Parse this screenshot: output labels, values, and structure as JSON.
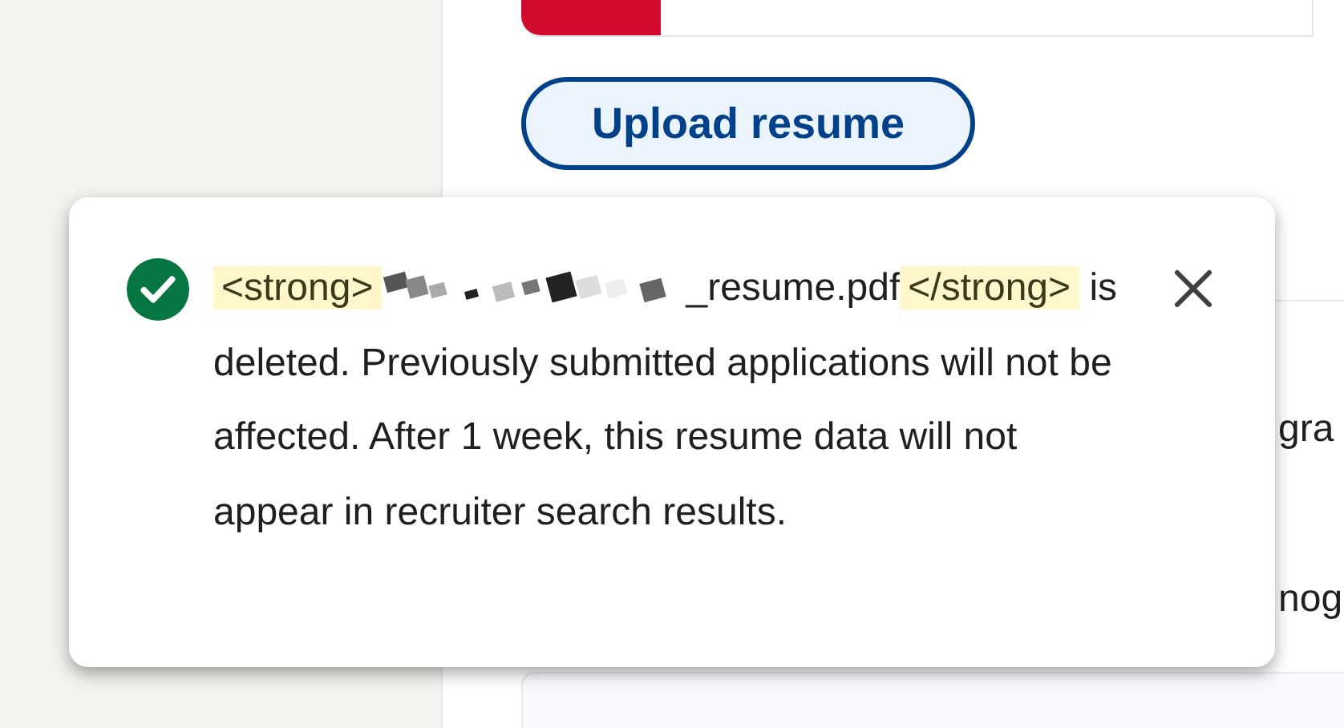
{
  "upload_button": {
    "label": "Upload resume"
  },
  "background_texts": [
    "gra",
    "nog"
  ],
  "toast": {
    "message": [
      {
        "kind": "code",
        "text": "<strong>"
      },
      {
        "kind": "redacted"
      },
      {
        "kind": "text",
        "text": "_resume.pdf"
      },
      {
        "kind": "code",
        "text": "</strong>"
      },
      {
        "kind": "text",
        "text": " is deleted. Previously submitted applications will not be affected. After 1 week, this resume data will not appear in recruiter search results."
      }
    ]
  }
}
